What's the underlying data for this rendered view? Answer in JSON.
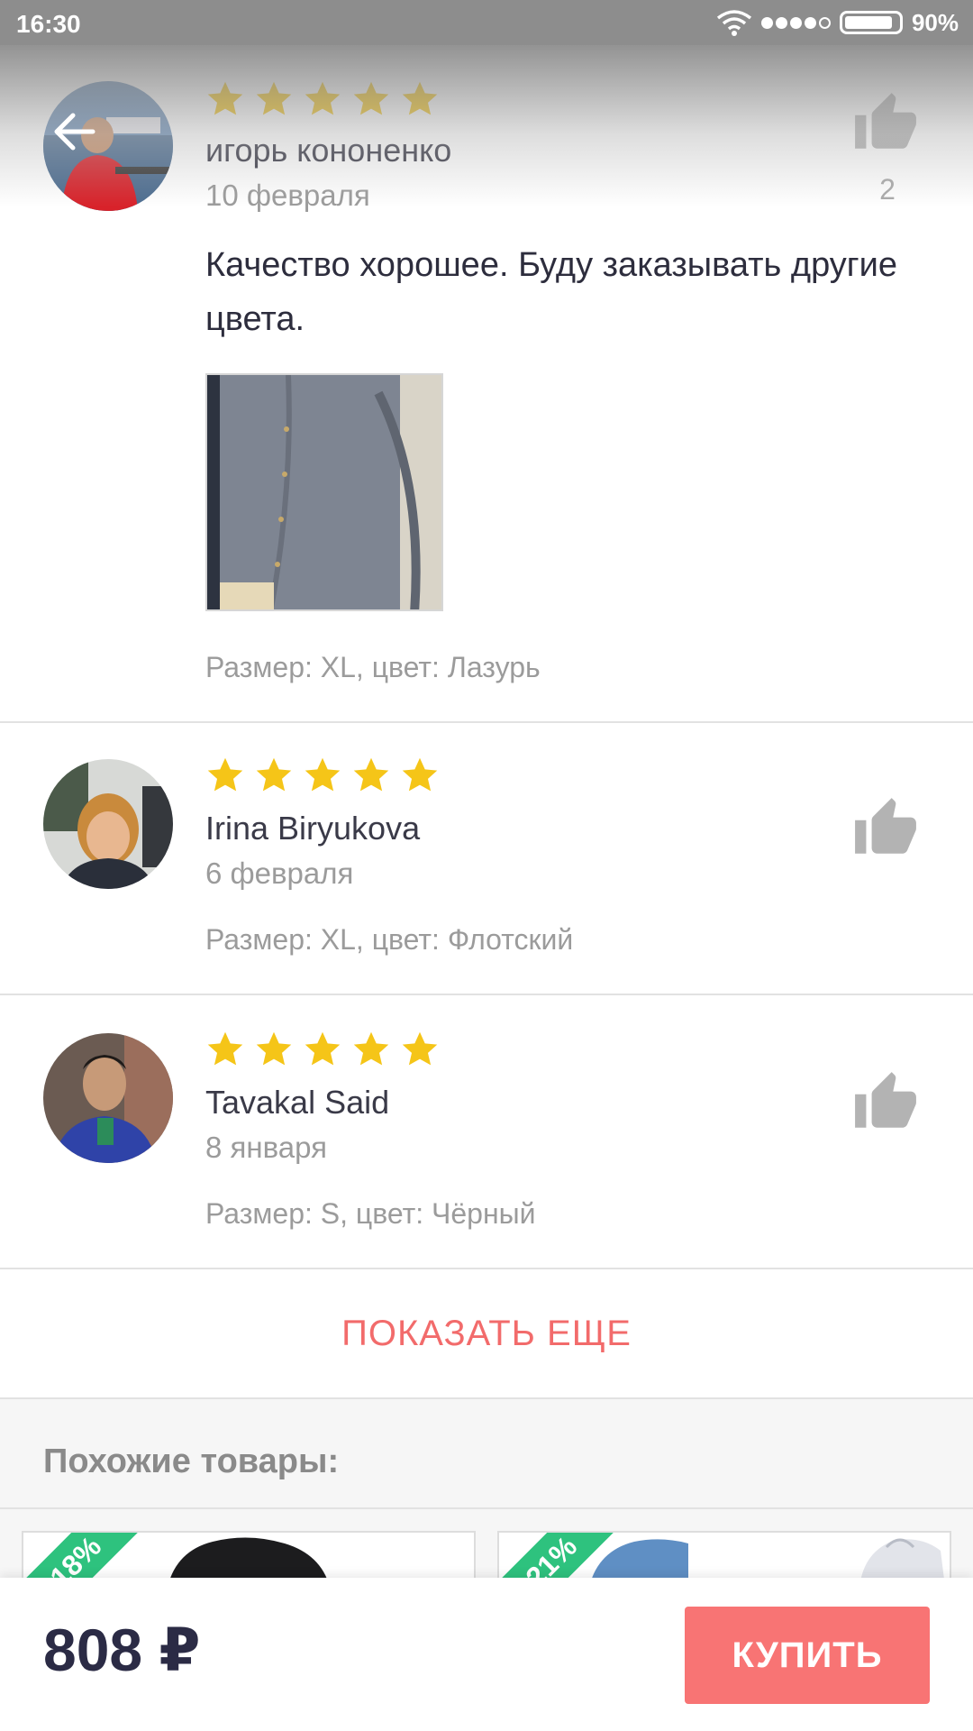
{
  "status_bar": {
    "time": "16:30",
    "battery": "90%"
  },
  "reviews": [
    {
      "name": "игорь кононенко",
      "date": "10 февраля",
      "rating": 5,
      "likes": "2",
      "text": "Качество хорошее. Буду заказывать другие цвета.",
      "variant": "Размер: XL, цвет: Лазурь"
    },
    {
      "name": "Irina Biryukova",
      "date": "6 февраля",
      "rating": 5,
      "variant": "Размер: XL, цвет: Флотский"
    },
    {
      "name": "Tavakal Said",
      "date": "8 января",
      "rating": 5,
      "variant": "Размер: S, цвет: Чёрный"
    }
  ],
  "show_more_label": "ПОКАЗАТЬ ЕЩЕ",
  "similar": {
    "title": "Похожие товары:",
    "products": [
      {
        "discount": "-18%"
      },
      {
        "discount": "-21%"
      }
    ]
  },
  "bottom_bar": {
    "price": "808 ₽",
    "buy_label": "КУПИТЬ"
  },
  "colors": {
    "star": "#f5c518",
    "accent": "#f87474",
    "discount": "#2ec27e"
  }
}
